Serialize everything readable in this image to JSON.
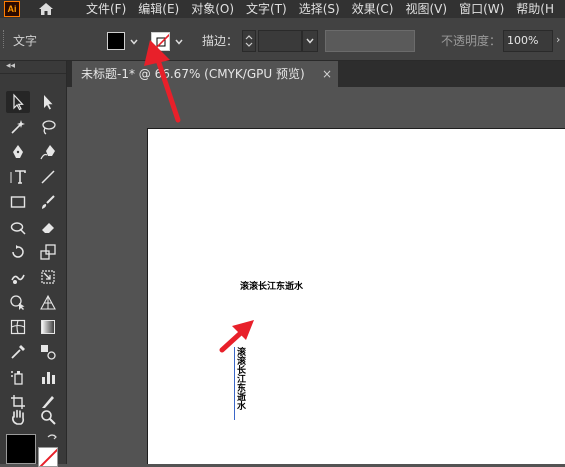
{
  "menubar": {
    "logo": "Ai",
    "items": [
      "文件(F)",
      "编辑(E)",
      "对象(O)",
      "文字(T)",
      "选择(S)",
      "效果(C)",
      "视图(V)",
      "窗口(W)",
      "帮助(H"
    ]
  },
  "controlbar": {
    "label": "文字",
    "stroke_label": "描边：",
    "opacity_label": "不透明度：",
    "opacity_value": "100%",
    "opacity_arrow": "›"
  },
  "tabs": {
    "doc_title": "未标题-1* @ 66.67% (CMYK/GPU 预览)",
    "close": "×"
  },
  "canvas": {
    "horizontal_text": "滚滚长江东逝水",
    "vertical_text": "滚滚长江东逝水"
  },
  "colors": {
    "annotation_arrow": "#e8202a",
    "selection": "#3a66c8",
    "ui_dark": "#323232",
    "canvas_bg": "#535353"
  },
  "toolbar": {
    "collapse": "◂◂",
    "tools": [
      "selection-tool",
      "direct-selection-tool",
      "magic-wand-tool",
      "lasso-tool",
      "pen-tool",
      "curvature-tool",
      "type-tool",
      "line-tool",
      "rectangle-tool",
      "paintbrush-tool",
      "shaper-tool",
      "eraser-tool",
      "rotate-tool",
      "scale-tool",
      "warp-tool",
      "free-transform-tool",
      "shape-builder-tool",
      "perspective-grid-tool",
      "mesh-tool",
      "gradient-tool",
      "eyedropper-tool",
      "blend-tool",
      "symbol-sprayer-tool",
      "column-graph-tool",
      "artboard-tool",
      "slice-tool",
      "hand-tool",
      "zoom-tool"
    ]
  }
}
